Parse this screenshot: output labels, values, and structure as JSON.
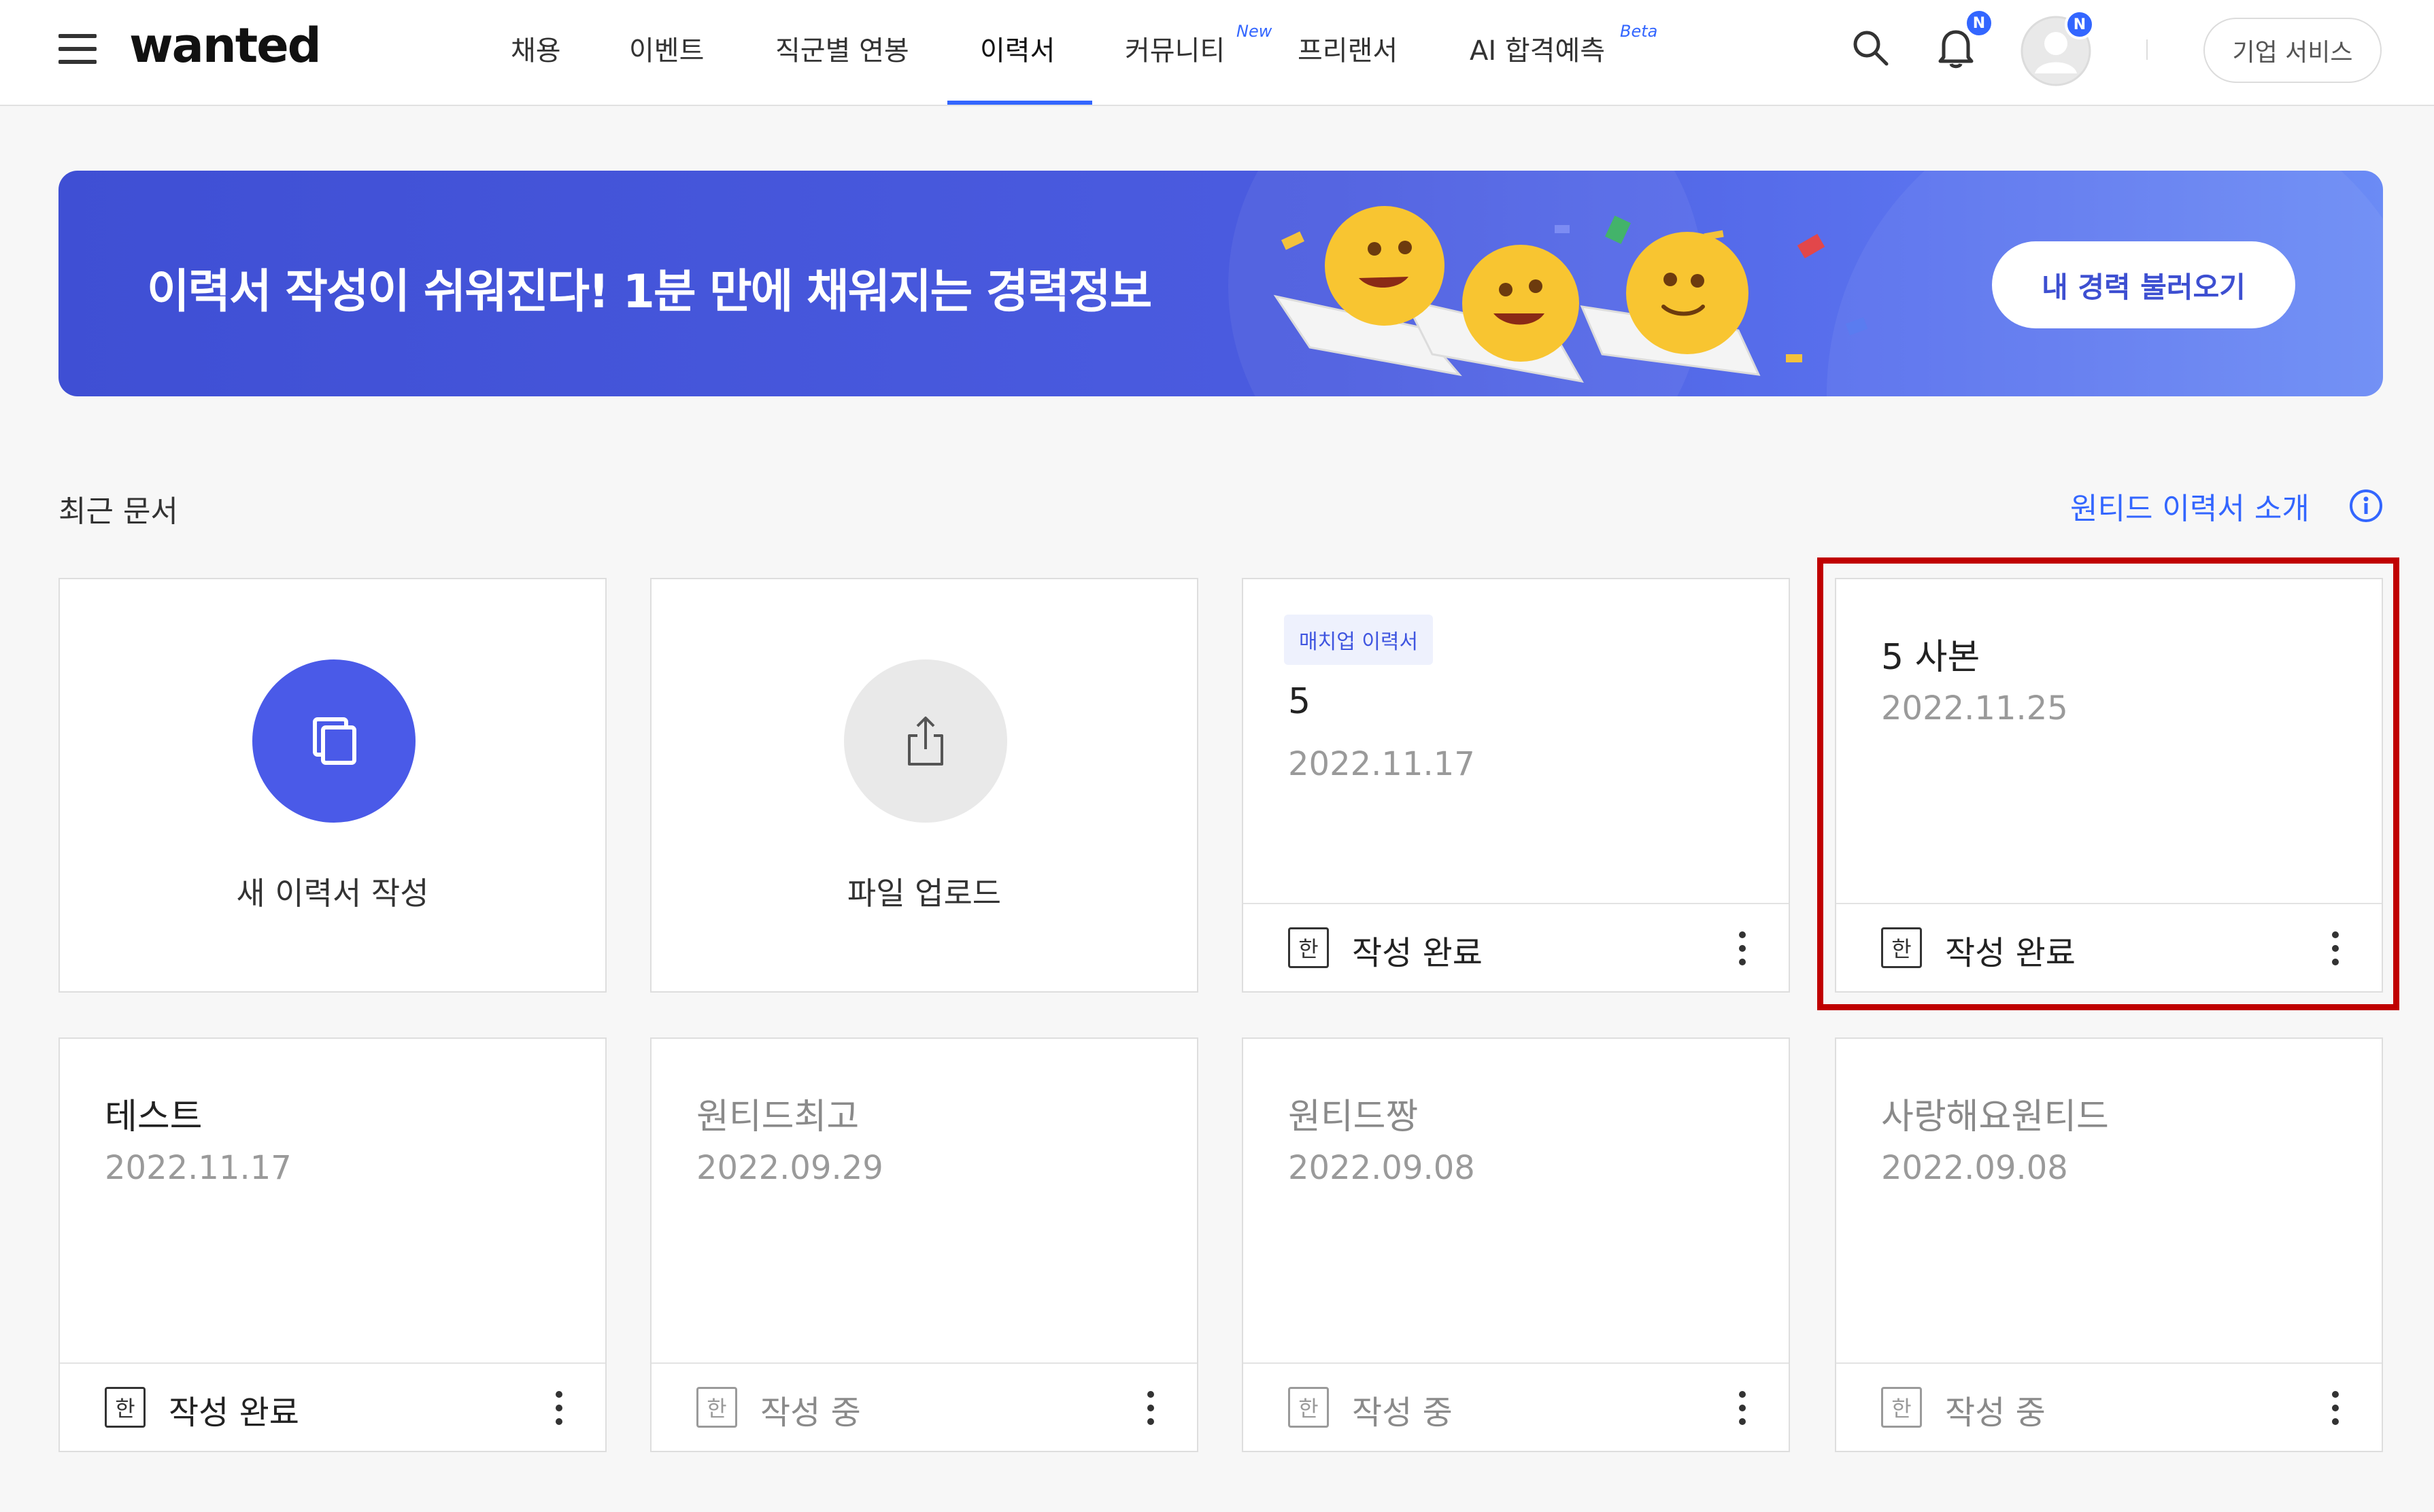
{
  "header": {
    "logo": "wanted",
    "nav": [
      {
        "label": "채용",
        "sup": ""
      },
      {
        "label": "이벤트",
        "sup": ""
      },
      {
        "label": "직군별 연봉",
        "sup": ""
      },
      {
        "label": "이력서",
        "sup": ""
      },
      {
        "label": "커뮤니티",
        "sup": "New"
      },
      {
        "label": "프리랜서",
        "sup": ""
      },
      {
        "label": "AI 합격예측",
        "sup": "Beta"
      }
    ],
    "active_nav": "이력서",
    "notification_badge": "N",
    "profile_badge": "N",
    "business_button": "기업 서비스",
    "accent_color": "#3366ff"
  },
  "banner": {
    "text": "이력서 작성이 쉬워진다! 1분 만에 채워지는 경력정보",
    "button": "내 경력 불러오기",
    "background": "#4453d8"
  },
  "section": {
    "title": "최근 문서",
    "intro_link": "원티드 이력서 소개"
  },
  "actions": {
    "new_resume": "새 이력서 작성",
    "file_upload": "파일 업로드"
  },
  "documents": [
    {
      "tag": "매치업 이력서",
      "title": "5",
      "date": "2022.11.17",
      "lang": "한",
      "status": "작성 완료",
      "dim": false
    },
    {
      "tag": "",
      "title": "5 사본",
      "date": "2022.11.25",
      "lang": "한",
      "status": "작성 완료",
      "dim": false,
      "highlighted": true
    },
    {
      "tag": "",
      "title": "테스트",
      "date": "2022.11.17",
      "lang": "한",
      "status": "작성 완료",
      "dim": false
    },
    {
      "tag": "",
      "title": "원티드최고",
      "date": "2022.09.29",
      "lang": "한",
      "status": "작성 중",
      "dim": true
    },
    {
      "tag": "",
      "title": "원티드짱",
      "date": "2022.09.08",
      "lang": "한",
      "status": "작성 중",
      "dim": true
    },
    {
      "tag": "",
      "title": "사랑해요원티드",
      "date": "2022.09.08",
      "lang": "한",
      "status": "작성 중",
      "dim": true
    }
  ],
  "icons": {
    "menu": "hamburger-menu-icon",
    "search": "search-icon",
    "notifications": "bell-icon",
    "profile": "avatar-icon",
    "new_resume": "copy-document-icon",
    "upload": "share-upload-icon",
    "info": "info-circle-icon",
    "more": "kebab-vertical-icon"
  }
}
